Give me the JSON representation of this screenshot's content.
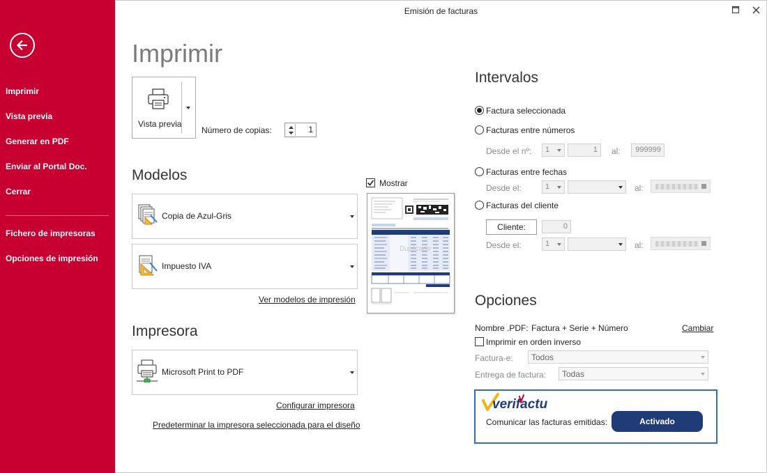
{
  "window": {
    "title": "Emisión de facturas"
  },
  "sidebar": {
    "items": [
      {
        "label": "Imprimir"
      },
      {
        "label": "Vista previa"
      },
      {
        "label": "Generar en PDF"
      },
      {
        "label": "Enviar al Portal Doc."
      },
      {
        "label": "Cerrar"
      },
      {
        "label": "Fichero de impresoras"
      },
      {
        "label": "Opciones de impresión"
      }
    ]
  },
  "print": {
    "title": "Imprimir",
    "preview_button_label": "Vista previa",
    "copies_label": "Número de copias:",
    "copies_value": "1"
  },
  "models": {
    "title": "Modelos",
    "show_label": "Mostrar",
    "show_checked": true,
    "items": [
      {
        "label": "Copia de Azul-Gris"
      },
      {
        "label": "Impuesto IVA"
      }
    ],
    "view_models_link": "Ver modelos de impresión",
    "preview_watermark": "Duplicado"
  },
  "printer": {
    "title": "Impresora",
    "selected": "Microsoft Print to PDF",
    "configure_link": "Configurar impresora",
    "default_link": "Predeterminar la impresora seleccionada para el diseño"
  },
  "intervals": {
    "title": "Intervalos",
    "options": [
      {
        "label": "Factura seleccionada",
        "selected": true
      },
      {
        "label": "Facturas entre números",
        "selected": false
      },
      {
        "label": "Facturas entre fechas",
        "selected": false
      },
      {
        "label": "Facturas del cliente",
        "selected": false
      }
    ],
    "numbers": {
      "from_label": "Desde el nº:",
      "series": "1",
      "from_value": "1",
      "to_label": "al:",
      "to_value": "999999"
    },
    "dates": {
      "from_label": "Desde el:",
      "series": "1",
      "to_label": "al:"
    },
    "client": {
      "button_label": "Cliente:",
      "value": "0",
      "from_label": "Desde el:",
      "series": "1",
      "to_label": "al:"
    }
  },
  "options": {
    "title": "Opciones",
    "pdf_name_label": "Nombre .PDF:",
    "pdf_name_value": "Factura + Serie + Número",
    "change_link": "Cambiar",
    "reverse_order_label": "Imprimir en orden inverso",
    "reverse_order_checked": false,
    "efactura_label": "Factura-e:",
    "efactura_value": "Todos",
    "delivery_label": "Entrega de factura:",
    "delivery_value": "Todas"
  },
  "verifactu": {
    "logo_text": "verifactu",
    "label": "Comunicar las facturas emitidas:",
    "button_label": "Activado",
    "brand_color": "#1f3b78",
    "border_color": "#2e6fb7"
  },
  "colors": {
    "sidebar": "#c80031"
  }
}
